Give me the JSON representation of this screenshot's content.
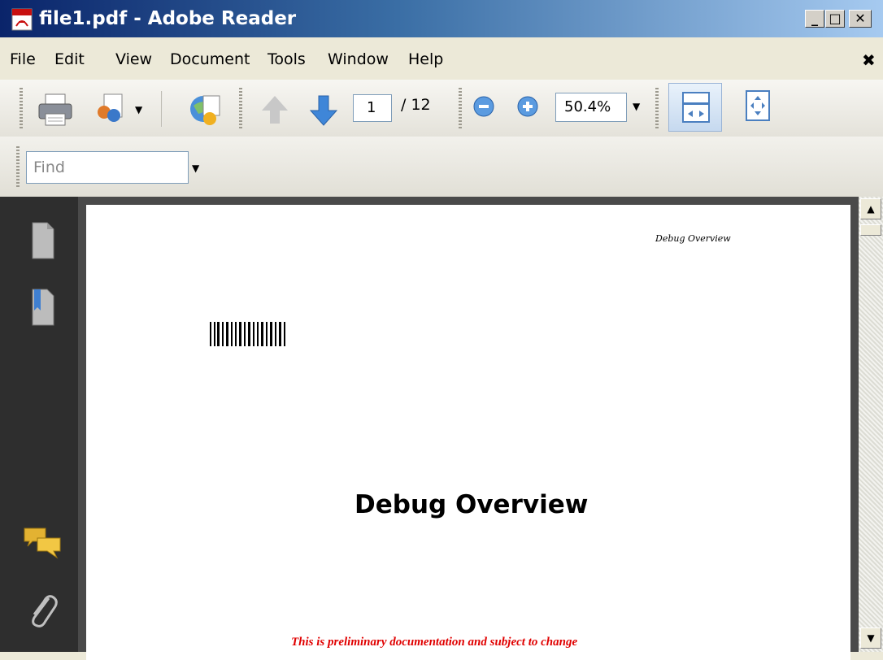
{
  "window": {
    "title": "file1.pdf - Adobe Reader",
    "controls": {
      "minimize": "_",
      "maximize": "□",
      "close": "✕"
    }
  },
  "menu": {
    "items": [
      "File",
      "Edit",
      "View",
      "Document",
      "Tools",
      "Window",
      "Help"
    ],
    "close_glyph": "✖"
  },
  "toolbar": {
    "page_current": "1",
    "page_total": "/ 12",
    "zoom": "50.4%",
    "icons": [
      "print-icon",
      "collaborate-icon",
      "search-web-icon",
      "previous-page-icon",
      "next-page-icon",
      "zoom-out-icon",
      "zoom-in-icon",
      "fit-width-icon",
      "fit-page-icon"
    ]
  },
  "find": {
    "placeholder": "Find"
  },
  "navpane": {
    "icons": [
      "pages-icon",
      "bookmarks-icon",
      "comments-icon",
      "attachments-icon"
    ]
  },
  "document": {
    "header": "Debug Overview",
    "title": "Debug Overview",
    "footer_notice": "This is preliminary documentation and subject to change"
  },
  "colors": {
    "titlebar_start": "#0a246a",
    "titlebar_end": "#a6caf0",
    "notice_red": "#e00000"
  }
}
